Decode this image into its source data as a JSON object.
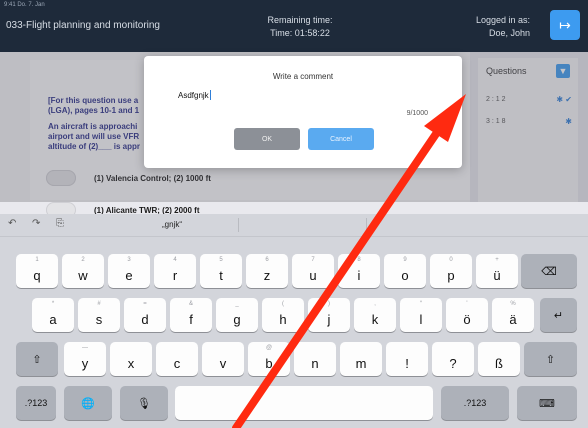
{
  "header": {
    "status": "9:41 Do. 7. Jan",
    "app_title": "033-Flight planning and monitoring",
    "remaining_label": "Remaining time:",
    "remaining_time": "Time: 01:58:22",
    "logged_label": "Logged in as:",
    "user": "Doe, John",
    "logout_icon": "logout-icon"
  },
  "question": {
    "line1": "[For this question use a",
    "line2": "(LGA), pages 10-1 and 1",
    "line3": "An aircraft is approachi",
    "line4": "airport and will use VFR",
    "line5": "altitude of (2)___ is appr",
    "options": [
      "(1) Valencia Control; (2) 1000 ft",
      "(1) Alicante TWR; (2) 2000 ft"
    ]
  },
  "panel": {
    "title": "Questions",
    "rows": [
      {
        "label": "2 : 1 2",
        "marks": "✱ ✔"
      },
      {
        "label": "3 : 1 8",
        "marks": "✱"
      }
    ]
  },
  "dialog": {
    "title": "Write a comment",
    "input_value": "Asdfgnjk",
    "counter": "9/1000",
    "ok_label": "OK",
    "cancel_label": "Cancel"
  },
  "suggestions": {
    "word": "„gnjk“"
  },
  "keyboard": {
    "row1": [
      {
        "k": "q",
        "a": "1"
      },
      {
        "k": "w",
        "a": "2"
      },
      {
        "k": "e",
        "a": "3"
      },
      {
        "k": "r",
        "a": "4"
      },
      {
        "k": "t",
        "a": "5"
      },
      {
        "k": "z",
        "a": "6"
      },
      {
        "k": "u",
        "a": "7"
      },
      {
        "k": "i",
        "a": "8"
      },
      {
        "k": "o",
        "a": "9"
      },
      {
        "k": "p",
        "a": "0"
      },
      {
        "k": "ü",
        "a": "+"
      }
    ],
    "row2": [
      {
        "k": "a",
        "a": "*"
      },
      {
        "k": "s",
        "a": "#"
      },
      {
        "k": "d",
        "a": "="
      },
      {
        "k": "f",
        "a": "&"
      },
      {
        "k": "g",
        "a": "_"
      },
      {
        "k": "h",
        "a": "("
      },
      {
        "k": "j",
        "a": ")"
      },
      {
        "k": "k",
        "a": "‚"
      },
      {
        "k": "l",
        "a": "“"
      },
      {
        "k": "ö",
        "a": "'"
      },
      {
        "k": "ä",
        "a": "%"
      }
    ],
    "row3": [
      {
        "k": "y",
        "a": "—"
      },
      {
        "k": "x",
        "a": ""
      },
      {
        "k": "c",
        "a": ""
      },
      {
        "k": "v",
        "a": ""
      },
      {
        "k": "b",
        "a": "@"
      },
      {
        "k": "n",
        "a": ""
      },
      {
        "k": "m",
        "a": ""
      },
      {
        "k": "!",
        "a": ""
      },
      {
        "k": "?",
        "a": ""
      },
      {
        "k": "ß",
        "a": ""
      }
    ],
    "num_label": ".?123",
    "num_label_right": ".?123"
  }
}
